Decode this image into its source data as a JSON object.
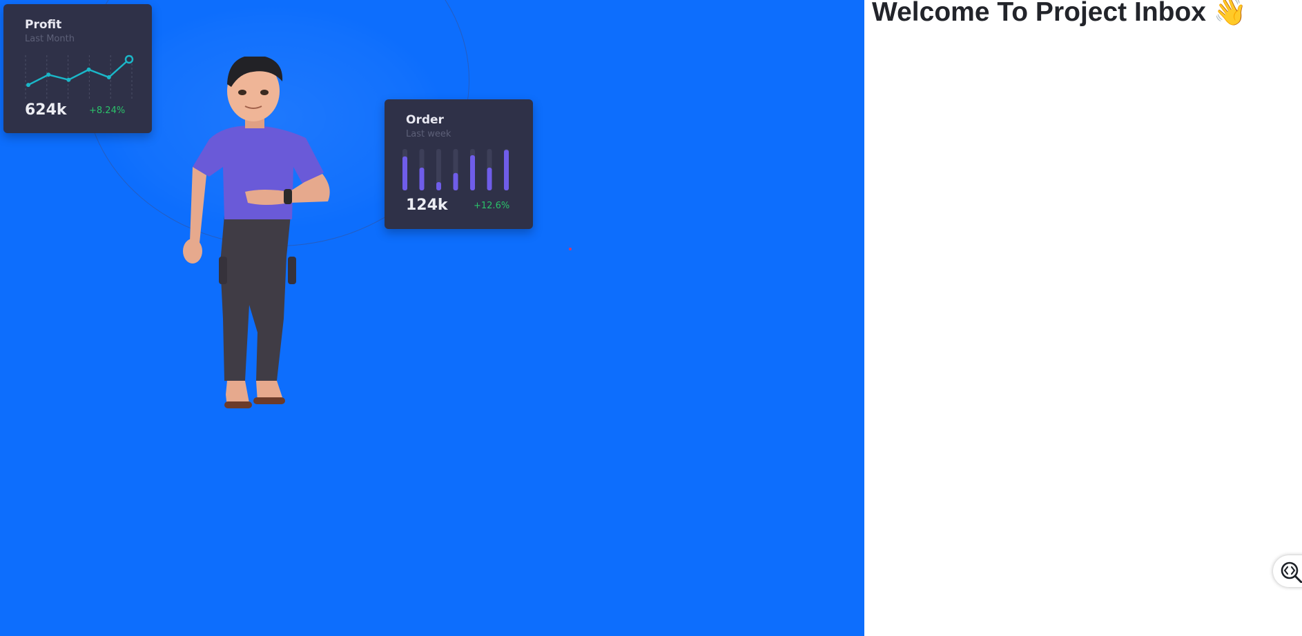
{
  "hero": {
    "background": "#0d6efd",
    "profit_card": {
      "title": "Profit",
      "subtitle": "Last Month",
      "value": "624k",
      "change": "+8.24%",
      "line_color": "#1bb7c8",
      "line_points": [
        2,
        4,
        3,
        5,
        3.5,
        7
      ]
    },
    "order_card": {
      "title": "Order",
      "subtitle": "Last week",
      "value": "124k",
      "change": "+12.6%",
      "bar_color": "#6f5de9",
      "bar_fractions": [
        0.82,
        0.55,
        0.2,
        0.42,
        0.85,
        0.55,
        0.98
      ]
    },
    "illustration": "3d-character-illustration"
  },
  "main": {
    "heading": "Welcome To Project Inbox",
    "heading_emoji": "👋"
  },
  "widget": {
    "icon": "code-search-icon"
  },
  "colors": {
    "card_bg": "#2f3148",
    "positive": "#2bc26a"
  }
}
